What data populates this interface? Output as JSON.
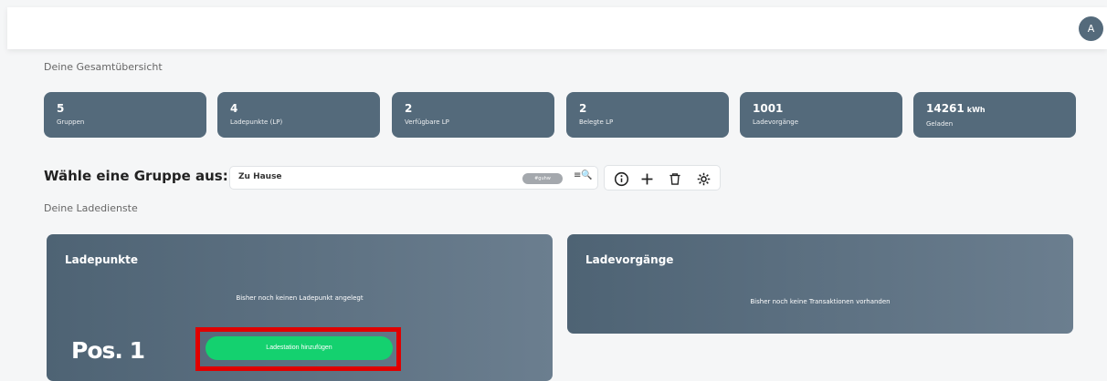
{
  "user": {
    "avatar_initial": "A"
  },
  "overview": {
    "title": "Deine Gesamtübersicht",
    "stats": [
      {
        "value": "5",
        "unit": "",
        "label": "Gruppen"
      },
      {
        "value": "4",
        "unit": "",
        "label": "Ladepunkte (LP)"
      },
      {
        "value": "2",
        "unit": "",
        "label": "Verfügbare LP"
      },
      {
        "value": "2",
        "unit": "",
        "label": "Belegte LP"
      },
      {
        "value": "1001",
        "unit": "",
        "label": "Ladevorgänge"
      },
      {
        "value": "14261",
        "unit": "kWh",
        "label": "Geladen"
      }
    ]
  },
  "group_selection": {
    "heading": "Wähle eine Gruppe aus:",
    "selected_group": "Zu Hause",
    "group_tag": "#guhw",
    "actions": [
      "info-icon",
      "plus-icon",
      "trash-icon",
      "gear-icon"
    ]
  },
  "services": {
    "title": "Deine Ladedienste",
    "ladepunkte": {
      "title": "Ladepunkte",
      "empty_message": "Bisher noch keinen Ladepunkt angelegt",
      "button_label": "Ladestation hinzufügen",
      "annotation": "Pos. 1"
    },
    "ladevorgaenge": {
      "title": "Ladevorgänge",
      "empty_message": "Bisher noch keine Transaktionen vorhanden"
    }
  },
  "colors": {
    "card": "#546a7b",
    "accent_green": "#14d16f",
    "highlight_red": "#e00000"
  }
}
